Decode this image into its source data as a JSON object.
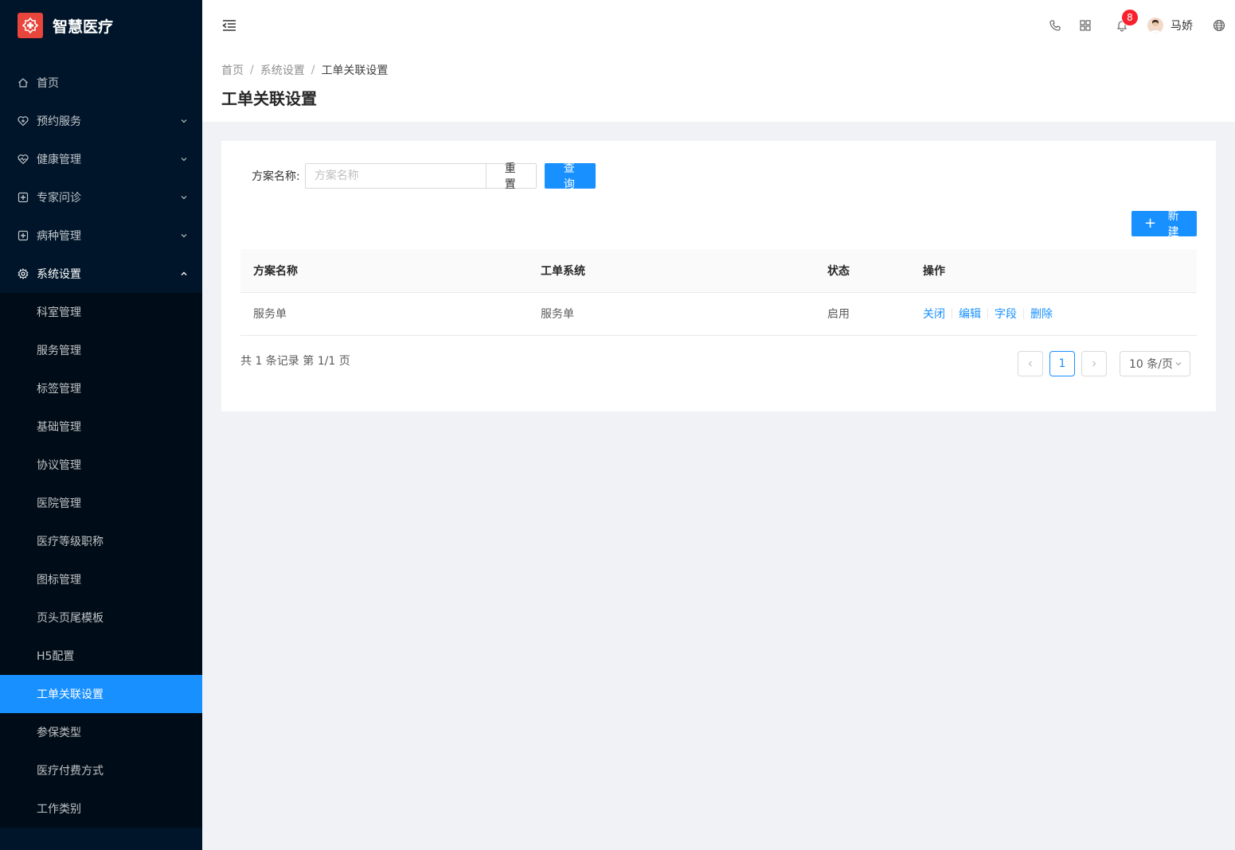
{
  "app": {
    "title": "智慧医疗"
  },
  "sidebar": {
    "items": [
      {
        "label": "首页",
        "icon": "home-icon",
        "has_arrow": false
      },
      {
        "label": "预约服务",
        "icon": "heart-shield-icon",
        "has_arrow": true
      },
      {
        "label": "健康管理",
        "icon": "heart-pulse-icon",
        "has_arrow": true
      },
      {
        "label": "专家问诊",
        "icon": "medical-plus-icon",
        "has_arrow": true
      },
      {
        "label": "病种管理",
        "icon": "medical-plus-icon",
        "has_arrow": true
      },
      {
        "label": "系统设置",
        "icon": "gear-icon",
        "has_arrow": true,
        "open": true
      }
    ],
    "submenu": [
      {
        "label": "科室管理"
      },
      {
        "label": "服务管理"
      },
      {
        "label": "标签管理"
      },
      {
        "label": "基础管理"
      },
      {
        "label": "协议管理"
      },
      {
        "label": "医院管理"
      },
      {
        "label": "医疗等级职称"
      },
      {
        "label": "图标管理"
      },
      {
        "label": "页头页尾模板"
      },
      {
        "label": "H5配置"
      },
      {
        "label": "工单关联设置",
        "active": true
      },
      {
        "label": "参保类型"
      },
      {
        "label": "医疗付费方式"
      },
      {
        "label": "工作类别"
      }
    ]
  },
  "header": {
    "notification_count": "8",
    "user_name": "马娇"
  },
  "breadcrumb": {
    "items": [
      "首页",
      "系统设置",
      "工单关联设置"
    ],
    "separator": "/"
  },
  "page": {
    "title": "工单关联设置"
  },
  "search": {
    "label": "方案名称:",
    "placeholder": "方案名称",
    "value": "",
    "reset_label": "重 置",
    "query_label": "查 询"
  },
  "toolbar": {
    "new_label": "新建"
  },
  "table": {
    "columns": [
      "方案名称",
      "工单系统",
      "状态",
      "操作"
    ],
    "rows": [
      {
        "name": "服务单",
        "system": "服务单",
        "status": "启用",
        "actions": [
          "关闭",
          "编辑",
          "字段",
          "删除"
        ]
      }
    ]
  },
  "pagination": {
    "summary": "共 1 条记录 第 1/1 页",
    "current_page": "1",
    "page_size": "10 条/页"
  },
  "colors": {
    "sidebar_bg": "#001529",
    "submenu_bg": "#000c17",
    "primary": "#1890ff",
    "logo_bg": "#e8453c",
    "badge": "#f5222d",
    "content_bg": "#f0f2f5"
  }
}
